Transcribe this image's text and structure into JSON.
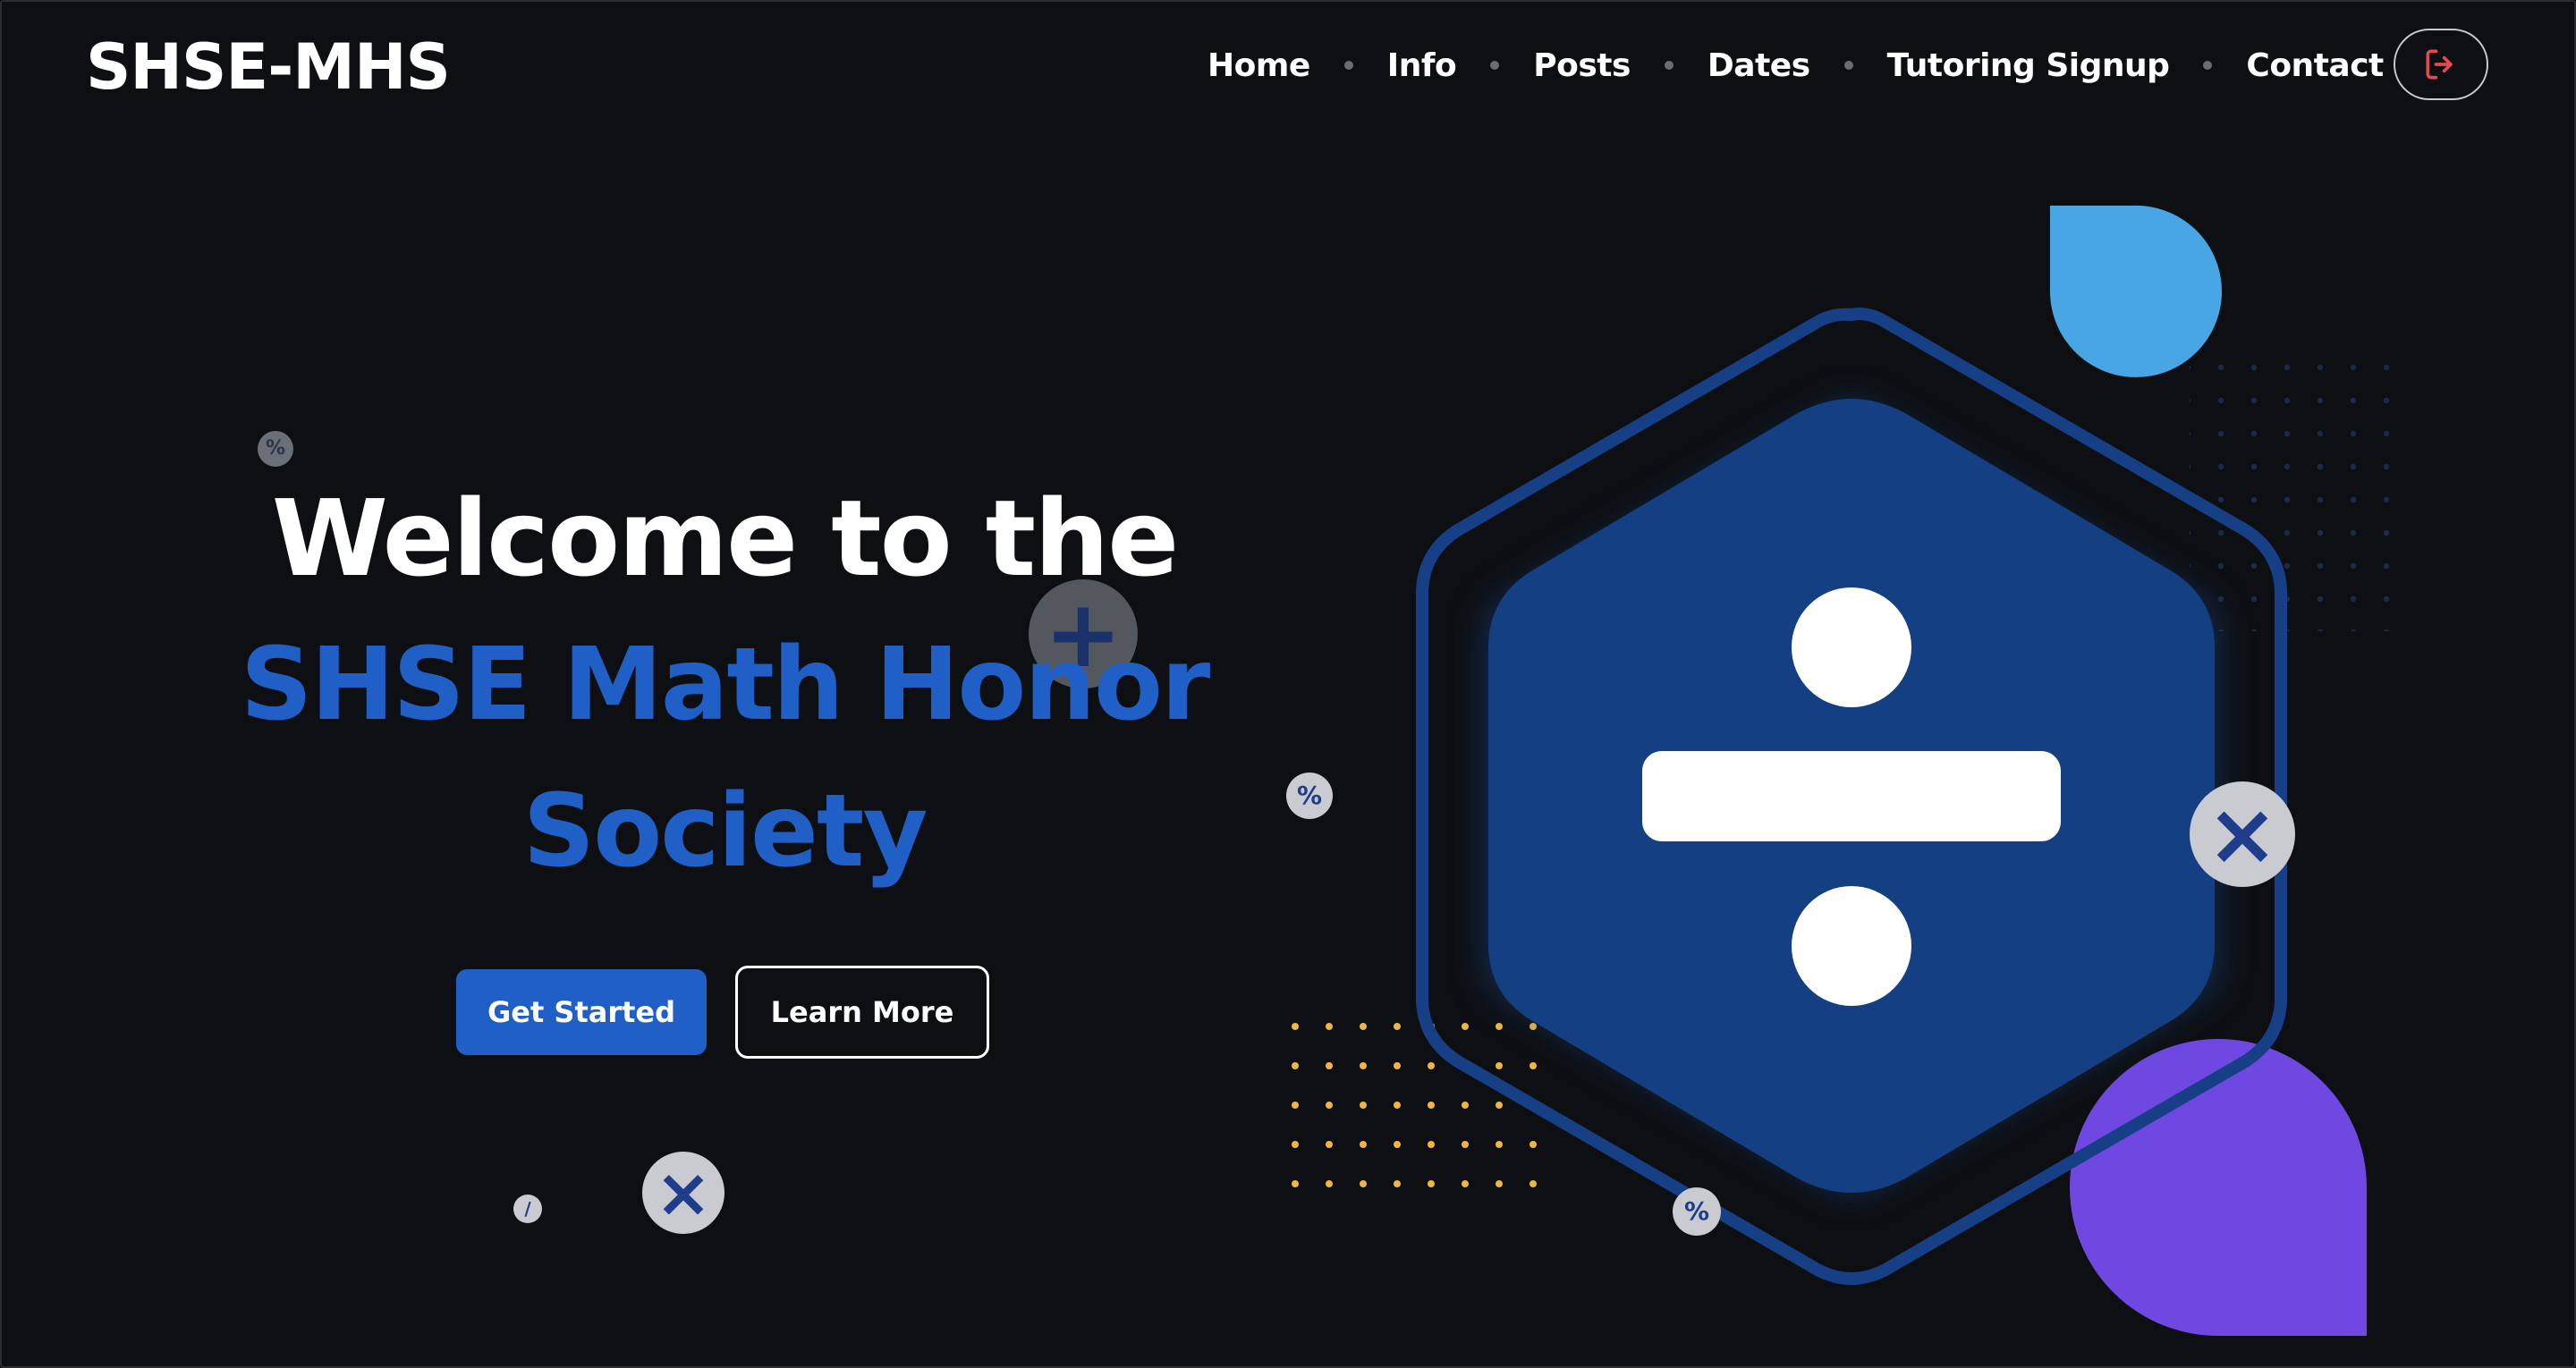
{
  "site": {
    "logo": "SHSE-MHS"
  },
  "nav": {
    "items": [
      "Home",
      "Info",
      "Posts",
      "Dates",
      "Tutoring Signup",
      "Contact"
    ],
    "logout_icon": "logout-icon"
  },
  "hero": {
    "line1": "Welcome to the",
    "line2": "SHSE Math Honor",
    "line3": "Society",
    "primary_button": "Get Started",
    "secondary_button": "Learn More"
  },
  "decor": {
    "symbols": {
      "percent": "%",
      "plus": "+",
      "times": "×",
      "slash": "/"
    }
  },
  "colors": {
    "background": "#0e0f12",
    "accent_blue": "#1f5fc6",
    "hexagon_fill": "#143f82",
    "hexagon_ring": "#173f86",
    "sky_blob": "#47a6e3",
    "purple_blob": "#6f48e2",
    "gold_dots": "#f0b640",
    "logout_red": "#e5484d"
  }
}
